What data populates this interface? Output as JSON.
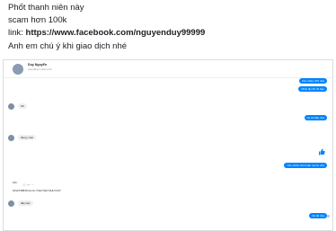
{
  "post": {
    "line1": "Phốt thanh niên này",
    "line2": "scam hơn 100k",
    "link_prefix": "link: ",
    "link_url": "https://www.facebook.com/nguyenduy99999",
    "line4": "Anh em chú ý khi giao dịch nhé"
  },
  "chat": {
    "contact_name": "Duy Nguyễn",
    "contact_status": "Hoạt động 2 phút trước",
    "messages": [
      {
        "dir": "out",
        "text": "Còn nhiêu 37k nha"
      },
      {
        "dir": "out",
        "text": "Mình lấy 90 rồi bạn"
      },
      {
        "dir": "in",
        "text": "Ok"
      },
      {
        "dir": "out",
        "text": "Ck tới đây nha"
      },
      {
        "dir": "in",
        "text": "đúng r bác"
      },
      {
        "dir": "out",
        "text": "Chu chinh chủ hoặc momo nhé"
      },
      {
        "dir": "in",
        "text": "bcb"
      },
      {
        "dir": "in",
        "text": "1812739815 tên tk: NGUYEN NHU DUY"
      },
      {
        "dir": "in",
        "text": "đây bác"
      },
      {
        "dir": "out",
        "text": "Ok đó nha"
      }
    ]
  },
  "icons": {
    "like": "thumbs-up-icon",
    "avatar": "user-avatar-icon"
  },
  "colors": {
    "outgoing_bubble": "#0084ff",
    "incoming_bubble": "#f1f0f0"
  }
}
